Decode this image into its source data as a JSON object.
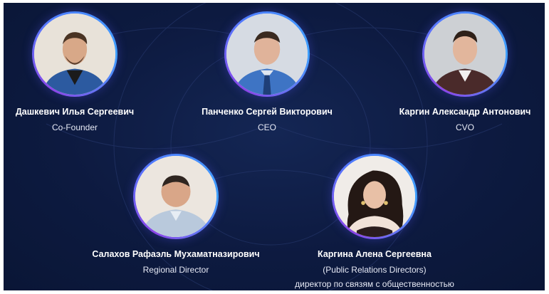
{
  "members": [
    {
      "name": "Дашкевич Илья Сергеевич",
      "role": "Co-Founder"
    },
    {
      "name": "Панченко Сергей Викторович",
      "role": "CEO"
    },
    {
      "name": "Каргин Александр Антонович",
      "role": "CVO"
    },
    {
      "name": "Салахов Рафаэль Мухаматназирович",
      "role": "Regional Director"
    },
    {
      "name": "Каргина Алена Сергеевна",
      "role": "(Public Relations Directors)",
      "role_secondary": "директор по связям с общественностью"
    }
  ],
  "colors": {
    "background": "#0d1a40",
    "ring_purple": "#8b45e8",
    "ring_blue": "#3fa0ff",
    "text": "#ffffff"
  }
}
